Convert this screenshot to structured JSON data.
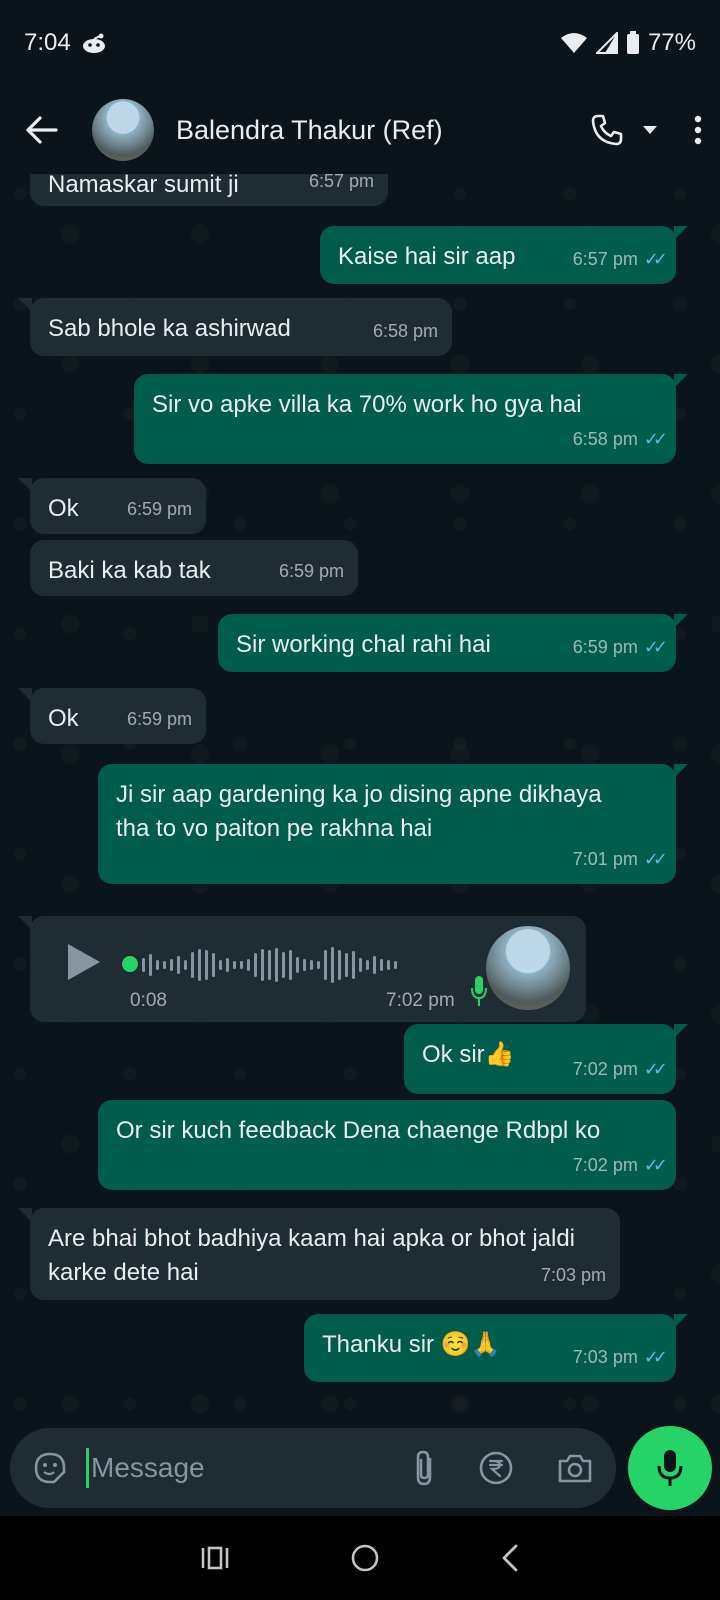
{
  "status_bar": {
    "time": "7:04",
    "battery": "77%"
  },
  "header": {
    "contact_name": "Balendra Thakur (Ref)"
  },
  "messages": [
    {
      "direction": "in",
      "text": "Namaskar sumit ji",
      "time": "6:57 pm"
    },
    {
      "direction": "out",
      "text": "Kaise hai sir aap",
      "time": "6:57 pm",
      "read": true
    },
    {
      "direction": "in",
      "text": "Sab bhole ka ashirwad",
      "time": "6:58 pm"
    },
    {
      "direction": "out",
      "text": "Sir vo apke villa ka 70% work ho gya hai",
      "time": "6:58 pm",
      "read": true
    },
    {
      "direction": "in",
      "text": "Ok",
      "time": "6:59 pm"
    },
    {
      "direction": "in",
      "text": "Baki ka kab tak",
      "time": "6:59 pm"
    },
    {
      "direction": "out",
      "text": "Sir working chal rahi hai",
      "time": "6:59 pm",
      "read": true
    },
    {
      "direction": "in",
      "text": "Ok",
      "time": "6:59 pm"
    },
    {
      "direction": "out",
      "text": "Ji sir aap gardening ka jo dising apne dikhaya tha to vo paiton pe rakhna hai",
      "time": "7:01 pm",
      "read": true
    },
    {
      "direction": "out",
      "text": "Ok sir👍",
      "time": "7:02 pm",
      "read": true
    },
    {
      "direction": "out",
      "text": "Or sir kuch feedback Dena chaenge Rdbpl ko",
      "time": "7:02 pm",
      "read": true
    },
    {
      "direction": "in",
      "text": "Are bhai bhot badhiya kaam hai apka or bhot jaldi karke dete hai",
      "time": "7:03 pm"
    },
    {
      "direction": "out",
      "text": "Thanku sir ☺️🙏",
      "time": "7:03 pm",
      "read": true
    }
  ],
  "voice_note": {
    "direction": "in",
    "duration": "0:08",
    "time": "7:02 pm",
    "progress": 0
  },
  "composer": {
    "placeholder": "Message"
  },
  "colors": {
    "background": "#0b141a",
    "incoming_bubble": "#202c33",
    "outgoing_bubble": "#005c4b",
    "accent_green": "#25d366",
    "read_tick_blue": "#53bdeb"
  },
  "icons": {
    "status": [
      "reddit-icon",
      "wifi-icon",
      "signal-icon",
      "battery-icon"
    ],
    "header": [
      "back-arrow-icon",
      "phone-icon",
      "chevron-down-icon",
      "more-vert-icon"
    ],
    "composer": [
      "sticker-icon",
      "attach-icon",
      "rupee-icon",
      "camera-icon",
      "mic-icon"
    ],
    "navigation": [
      "recents-icon",
      "home-icon",
      "back-icon"
    ]
  }
}
